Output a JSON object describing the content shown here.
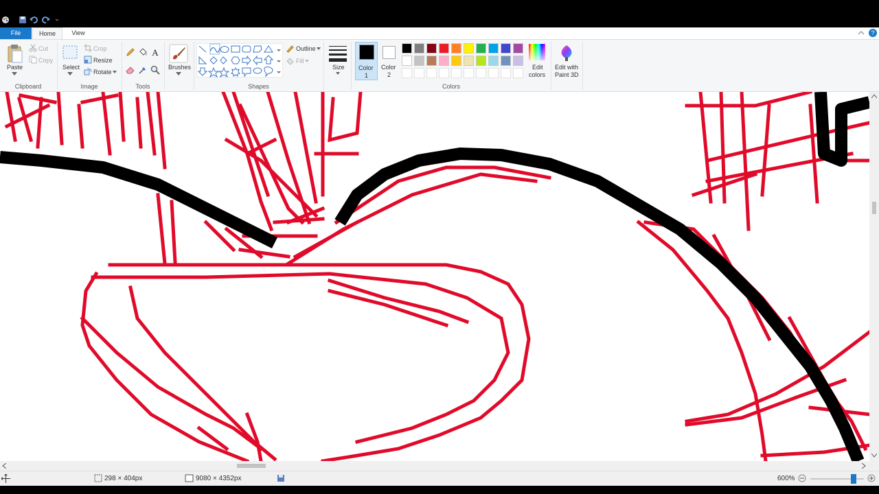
{
  "tabs": {
    "file": "File",
    "home": "Home",
    "view": "View"
  },
  "clipboard": {
    "paste": "Paste",
    "cut": "Cut",
    "copy": "Copy",
    "group": "Clipboard"
  },
  "image": {
    "select": "Select",
    "crop": "Crop",
    "resize": "Resize",
    "rotate": "Rotate",
    "group": "Image"
  },
  "tools": {
    "group": "Tools"
  },
  "brushes": {
    "label": "Brushes"
  },
  "shapes": {
    "outline": "Outline",
    "fill": "Fill",
    "group": "Shapes"
  },
  "size": {
    "label": "Size"
  },
  "colors": {
    "color1": "Color",
    "color1_num": "1",
    "color2": "Color",
    "color2_num": "2",
    "edit_colors_1": "Edit",
    "edit_colors_2": "colors",
    "paint3d_1": "Edit with",
    "paint3d_2": "Paint 3D",
    "group": "Colors",
    "color1_value": "#000000",
    "color2_value": "#ffffff",
    "palette_row1": [
      "#000000",
      "#7f7f7f",
      "#880015",
      "#ed1c24",
      "#ff7f27",
      "#fff200",
      "#22b14c",
      "#00a2e8",
      "#3f48cc",
      "#a349a4"
    ],
    "palette_row2": [
      "#ffffff",
      "#c3c3c3",
      "#b97a57",
      "#ffaec9",
      "#ffc90e",
      "#efe4b0",
      "#b5e61d",
      "#99d9ea",
      "#7092be",
      "#c8bfe7"
    ]
  },
  "drawing": {
    "red": "#e00b2a",
    "black": "#000000"
  },
  "status": {
    "selection": "298 × 404px",
    "image_size": "9080 × 4352px",
    "zoom": "600%",
    "zoom_level": 0.84
  }
}
